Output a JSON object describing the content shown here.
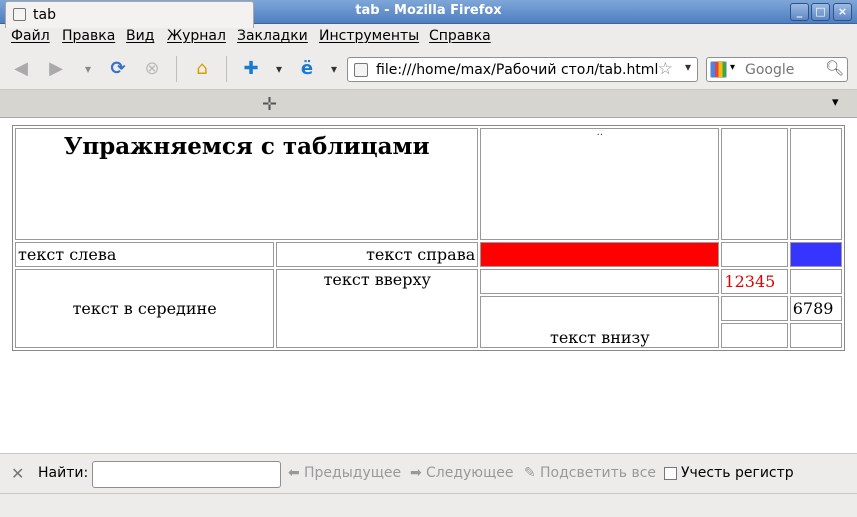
{
  "window": {
    "title": "tab - Mozilla Firefox"
  },
  "menu": [
    "Файл",
    "Правка",
    "Вид",
    "Журнал",
    "Закладки",
    "Инструменты",
    "Справка"
  ],
  "urlbar": {
    "value": "file:///home/max/Рабочий стол/tab.html"
  },
  "search": {
    "placeholder": "Google"
  },
  "tab": {
    "label": "tab"
  },
  "page": {
    "heading": "Упражняемся с таблицами",
    "dots": "..",
    "left_text": "текст слева",
    "right_text": "текст справа",
    "middle_text": "текст в середине",
    "top_text": "текст вверху",
    "bottom_text": "текст внизу",
    "num1": "12345",
    "num2": "6789",
    "colors": {
      "red": "#ff0000",
      "blue": "#3535ff",
      "num1": "#e00000"
    }
  },
  "findbar": {
    "label": "Найти:",
    "prev": "Предыдущее",
    "next": "Следующее",
    "highlight": "Подсветить все",
    "match_case": "Учесть регистр"
  }
}
